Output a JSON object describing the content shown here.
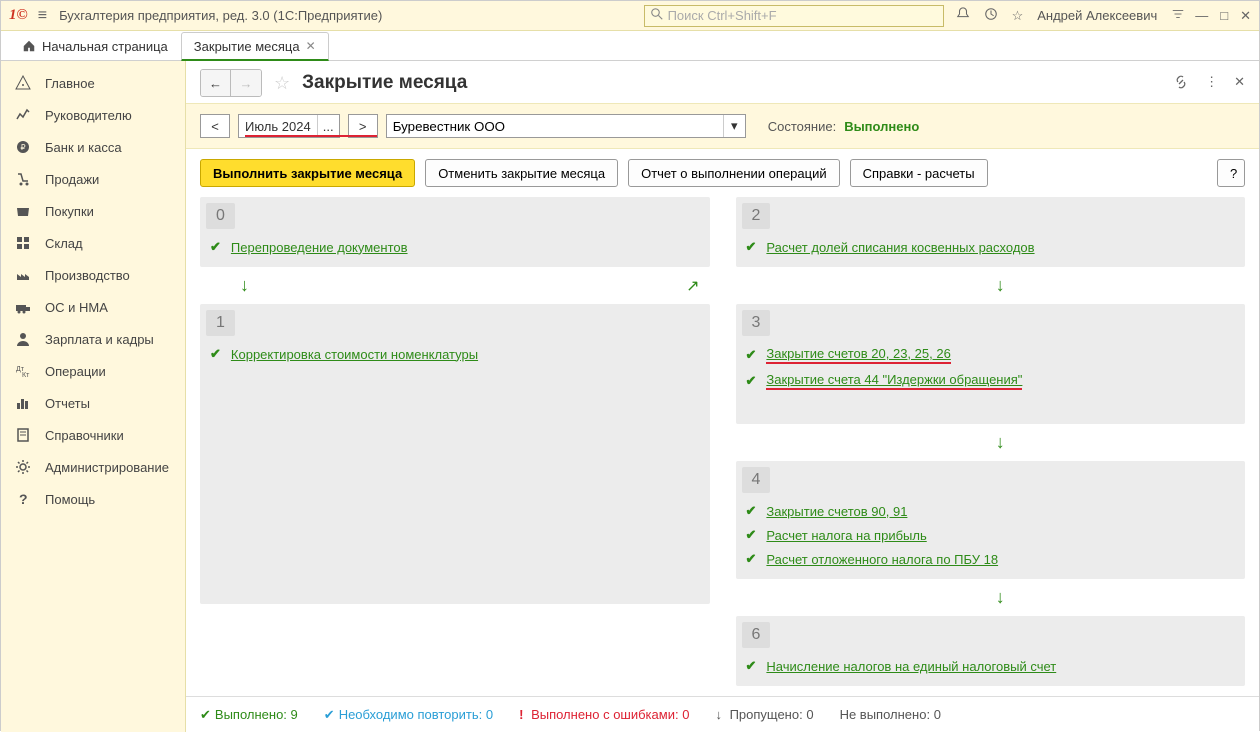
{
  "titlebar": {
    "app_title": "Бухгалтерия предприятия, ред. 3.0  (1С:Предприятие)",
    "search_placeholder": "Поиск Ctrl+Shift+F",
    "user": "Андрей Алексеевич"
  },
  "tabs": {
    "home": "Начальная страница",
    "active": "Закрытие месяца"
  },
  "sidebar": [
    "Главное",
    "Руководителю",
    "Банк и касса",
    "Продажи",
    "Покупки",
    "Склад",
    "Производство",
    "ОС и НМА",
    "Зарплата и кадры",
    "Операции",
    "Отчеты",
    "Справочники",
    "Администрирование",
    "Помощь"
  ],
  "page": {
    "title": "Закрытие месяца",
    "prev": "<",
    "next": ">",
    "period": "Июль 2024",
    "ellipsis": "...",
    "org": "Буревестник ООО",
    "state_label": "Состояние:",
    "state_value": "Выполнено"
  },
  "actions": {
    "run": "Выполнить закрытие месяца",
    "cancel": "Отменить закрытие месяца",
    "report": "Отчет о выполнении операций",
    "calc": "Справки - расчеты",
    "help": "?"
  },
  "stages": {
    "s0": {
      "num": "0",
      "ops": [
        "Перепроведение документов"
      ]
    },
    "s1": {
      "num": "1",
      "ops": [
        "Корректировка стоимости номенклатуры"
      ]
    },
    "s2": {
      "num": "2",
      "ops": [
        "Расчет долей списания косвенных расходов"
      ]
    },
    "s3": {
      "num": "3",
      "ops": [
        "Закрытие счетов 20, 23, 25, 26",
        "Закрытие счета 44 \"Издержки обращения\""
      ]
    },
    "s4": {
      "num": "4",
      "ops": [
        "Закрытие счетов 90, 91",
        "Расчет налога на прибыль",
        "Расчет отложенного налога по ПБУ 18"
      ]
    },
    "s6": {
      "num": "6",
      "ops": [
        "Начисление налогов на единый налоговый счет"
      ]
    }
  },
  "footer": {
    "done_label": "Выполнено:",
    "done_count": "9",
    "repeat_label": "Необходимо повторить:",
    "repeat_count": "0",
    "err_label": "Выполнено с ошибками:",
    "err_count": "0",
    "skip_label": "Пропущено:",
    "skip_count": "0",
    "notdone_label": "Не выполнено:",
    "notdone_count": "0"
  }
}
